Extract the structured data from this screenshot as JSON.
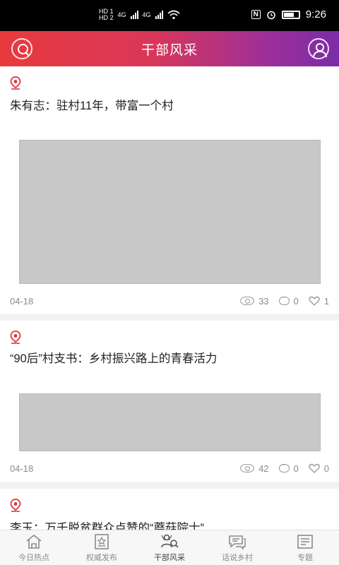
{
  "status_bar": {
    "time": "9:26",
    "hd1": "HD 1",
    "hd2": "HD 2",
    "network1": "4G",
    "network2": "4G",
    "nfc": "N"
  },
  "header": {
    "title": "干部风采",
    "accent_start": "#e83a3c",
    "accent_end": "#7a2ca8"
  },
  "feed": {
    "items": [
      {
        "title": "朱有志：驻村11年，带富一个村",
        "date": "04-18",
        "views": "33",
        "comments": "0",
        "likes": "1",
        "image_alt": "[photo]"
      },
      {
        "title": "“90后”村支书：乡村振兴路上的青春活力",
        "date": "04-18",
        "views": "42",
        "comments": "0",
        "likes": "0",
        "image_alt": "[photo]"
      },
      {
        "title": "李玉：万千脱贫群众点赞的“蘑菇院士”"
      }
    ]
  },
  "tabs": [
    {
      "label": "今日热点",
      "icon": "home-icon"
    },
    {
      "label": "权威发布",
      "icon": "star-doc-icon"
    },
    {
      "label": "干部风采",
      "icon": "person-network-icon",
      "active": true
    },
    {
      "label": "话说乡村",
      "icon": "chat-icon"
    },
    {
      "label": "专题",
      "icon": "topic-doc-icon"
    }
  ]
}
